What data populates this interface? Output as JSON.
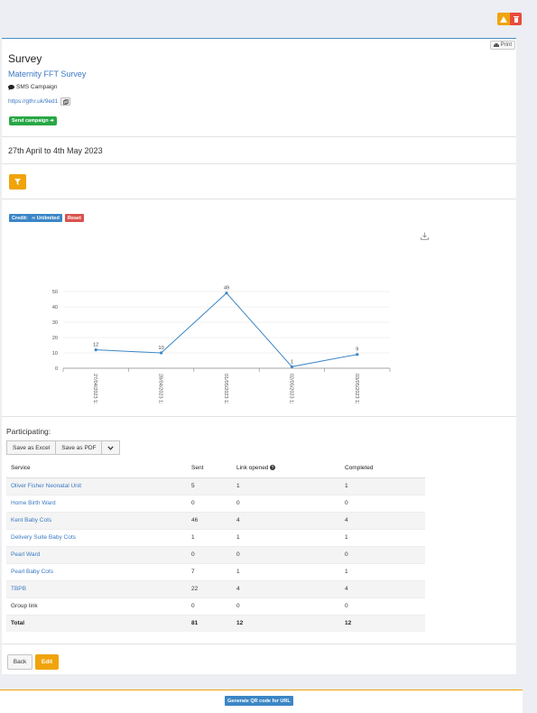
{
  "page": {
    "title": "Survey",
    "survey_name": "Maternity FFT Survey",
    "campaign_type": "SMS Campaign",
    "short_url": "https://gthr.uk/9ed1",
    "send_campaign_label": "Send campaign ➔",
    "print_label": "Print",
    "date_range": "27th April to 4th May 2023"
  },
  "badges": {
    "credit_label": "Credit:",
    "credit_value": "∞ Unlimited",
    "reset_label": "Reset"
  },
  "icons": {
    "warning": "warning-icon",
    "delete": "trash-icon",
    "print": "printer-icon",
    "campaign": "chat-bubble-icon",
    "copy": "copy-icon",
    "filter": "filter-icon",
    "download": "download-icon",
    "help": "question-circle-icon",
    "dropdown": "chevron-down-icon"
  },
  "colors": {
    "accent_orange": "#f0a30a",
    "danger": "#e74c3c",
    "success": "#27a745",
    "link": "#3b7ac3",
    "line": "#3b86c6"
  },
  "chart_data": {
    "type": "line",
    "x": [
      "27/04/2023 12:08",
      "28/04/2023 12:14",
      "01/05/2023 12:25",
      "02/05/2023 12:26",
      "03/05/2023 12:15"
    ],
    "values": [
      12,
      10,
      49,
      1,
      9
    ],
    "data_labels": [
      "12",
      "10",
      "49",
      "1",
      "9"
    ],
    "yticks": [
      "0",
      "10",
      "20",
      "30",
      "40",
      "50"
    ],
    "ylim": [
      0,
      50
    ],
    "grid": true,
    "title": "",
    "xlabel": "",
    "ylabel": ""
  },
  "participating": {
    "heading": "Participating:",
    "buttons": [
      "Save as Excel",
      "Save as PDF"
    ],
    "columns": [
      "Service",
      "Sent",
      "Link opened",
      "Completed"
    ],
    "rows": [
      {
        "service": "Oliver Fisher Neonatal Unit",
        "sent": "5",
        "opened": "1",
        "completed": "1"
      },
      {
        "service": "Home Birth Ward",
        "sent": "0",
        "opened": "0",
        "completed": "0"
      },
      {
        "service": "Kent Baby Cots",
        "sent": "46",
        "opened": "4",
        "completed": "4"
      },
      {
        "service": "Delivery Suite Baby Cots",
        "sent": "1",
        "opened": "1",
        "completed": "1"
      },
      {
        "service": "Pearl Ward",
        "sent": "0",
        "opened": "0",
        "completed": "0"
      },
      {
        "service": "Pearl Baby Cots",
        "sent": "7",
        "opened": "1",
        "completed": "1"
      },
      {
        "service": "TBPB",
        "sent": "22",
        "opened": "4",
        "completed": "4"
      },
      {
        "service": "Group link",
        "sent": "0",
        "opened": "0",
        "completed": "0"
      }
    ],
    "total": {
      "service": "Total",
      "sent": "81",
      "opened": "12",
      "completed": "12"
    }
  },
  "actions": {
    "back_label": "Back",
    "edit_label": "Edit",
    "qr_label": "Generate QR code for URL"
  }
}
